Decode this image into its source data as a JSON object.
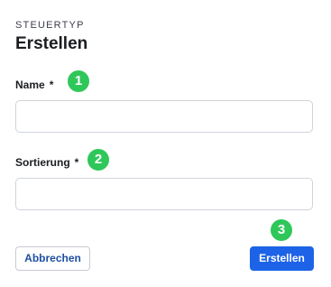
{
  "form": {
    "overline": "STEUERTYP",
    "title": "Erstellen",
    "fields": [
      {
        "label": "Name",
        "required_mark": "*",
        "value": "",
        "placeholder": ""
      },
      {
        "label": "Sortierung",
        "required_mark": "*",
        "value": "",
        "placeholder": ""
      }
    ],
    "buttons": {
      "cancel_label": "Abbrechen",
      "submit_label": "Erstellen"
    }
  },
  "markers": [
    "1",
    "2",
    "3"
  ],
  "colors": {
    "primary_button": "#1d63e8",
    "marker_badge": "#2fc75a",
    "cancel_text": "#1d4fa3",
    "input_border": "#cfd4da"
  }
}
